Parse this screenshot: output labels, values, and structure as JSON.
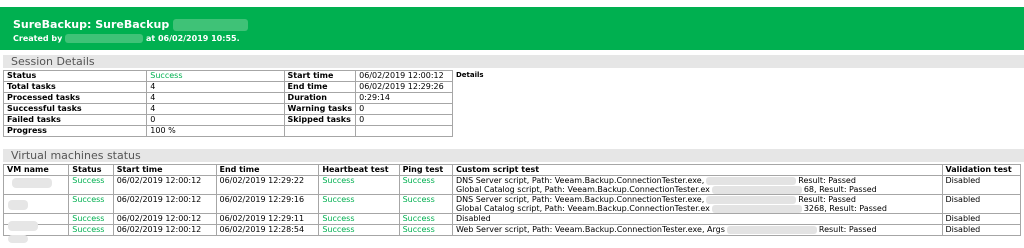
{
  "header": {
    "title": "SureBackup: SureBackup",
    "created_prefix": "Created by",
    "created_suffix": "at 06/02/2019 10:55."
  },
  "sections": {
    "session": "Session Details",
    "vms": "Virtual machines status"
  },
  "session": {
    "left": [
      {
        "label": "Status",
        "value": "Success",
        "green": true
      },
      {
        "label": "Total tasks",
        "value": "4"
      },
      {
        "label": "Processed tasks",
        "value": "4"
      },
      {
        "label": "Successful tasks",
        "value": "4"
      },
      {
        "label": "Failed tasks",
        "value": "0"
      },
      {
        "label": "Progress",
        "value": "100 %"
      }
    ],
    "right": [
      {
        "label": "Start time",
        "value": "06/02/2019 12:00:12"
      },
      {
        "label": "End time",
        "value": "06/02/2019 12:29:26"
      },
      {
        "label": "Duration",
        "value": "0:29:14"
      },
      {
        "label": "Warning tasks",
        "value": "0"
      },
      {
        "label": "Skipped tasks",
        "value": "0"
      }
    ],
    "details_label": "Details"
  },
  "vm_table": {
    "headers": [
      "VM name",
      "Status",
      "Start time",
      "End time",
      "Heartbeat test",
      "Ping test",
      "Custom script test",
      "Validation test"
    ],
    "rows": [
      {
        "status": "Success",
        "start": "06/02/2019 12:00:12",
        "end": "06/02/2019 12:29:22",
        "heartbeat": "Success",
        "ping": "Success",
        "script1a": "DNS Server script, Path: Veeam.Backup.ConnectionTester.exe,",
        "script1b": "Result: Passed",
        "script2a": "Global Catalog script, Path: Veeam.Backup.ConnectionTester.ex",
        "script2b": "68, Result: Passed",
        "validation": "Disabled"
      },
      {
        "status": "Success",
        "start": "06/02/2019 12:00:12",
        "end": "06/02/2019 12:29:16",
        "heartbeat": "Success",
        "ping": "Success",
        "script1a": "DNS Server script, Path: Veeam.Backup.ConnectionTester.exe,",
        "script1b": "Result: Passed",
        "script2a": "Global Catalog script, Path: Veeam.Backup.ConnectionTester.ex",
        "script2b": "3268, Result: Passed",
        "validation": "Disabled"
      },
      {
        "status": "Success",
        "start": "06/02/2019 12:00:12",
        "end": "06/02/2019 12:29:11",
        "heartbeat": "Success",
        "ping": "Success",
        "script1a": "Disabled",
        "validation": "Disabled"
      },
      {
        "status": "Success",
        "start": "06/02/2019 12:00:12",
        "end": "06/02/2019 12:28:54",
        "heartbeat": "Success",
        "ping": "Success",
        "script1a": "Web Server script, Path: Veeam.Backup.ConnectionTester.exe, Args",
        "script1b": "Result: Passed",
        "validation": "Disabled"
      }
    ]
  }
}
